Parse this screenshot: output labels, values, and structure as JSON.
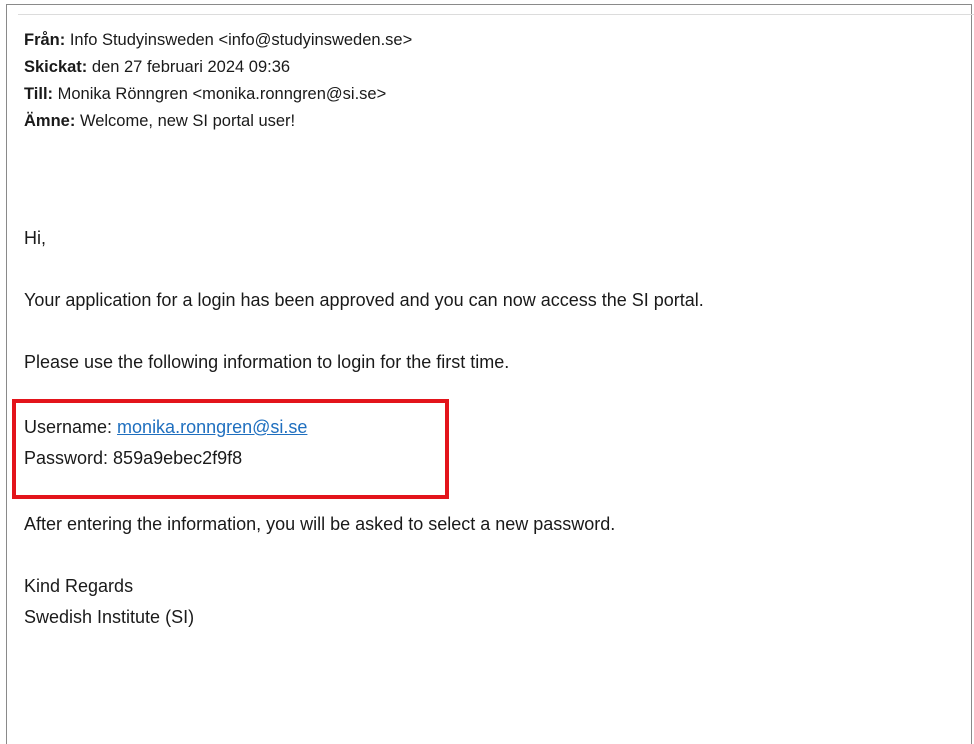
{
  "email": {
    "headers": [
      {
        "label": "Från:",
        "value": "Info Studyinsweden <info@studyinsweden.se>"
      },
      {
        "label": "Skickat:",
        "value": "den 27 februari 2024 09:36"
      },
      {
        "label": "Till:",
        "value": "Monika Rönngren <monika.ronngren@si.se>"
      },
      {
        "label": "Ämne:",
        "value": "Welcome, new SI portal user!"
      }
    ],
    "greeting": "Hi,",
    "paragraph1": "Your application for a login has been approved and you can now access the SI portal.",
    "paragraph2": "Please use the following information to login for the first time.",
    "credentials": {
      "username_label": "Username: ",
      "username_value": "monika.ronngren@si.se",
      "password_label": "Password: ",
      "password_value": "859a9ebec2f9f8"
    },
    "paragraph3": "After entering the information, you will be asked to select a new password.",
    "signoff": "Kind Regards",
    "signature": "Swedish Institute (SI)"
  },
  "colors": {
    "link": "#1f6fbf",
    "highlight_border": "#e3141b",
    "frame_border": "#8a8a8a"
  }
}
